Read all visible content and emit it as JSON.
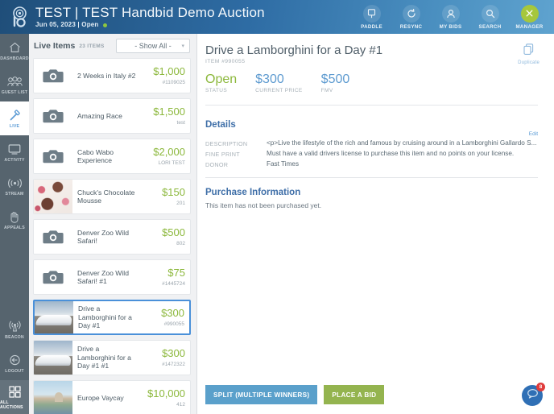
{
  "header": {
    "logo_icon": "handbid-logo-icon",
    "title": "TEST | TEST Handbid Demo Auction",
    "subtitle": "Jun 05, 2023 | Open",
    "actions": [
      {
        "label": "PADDLE",
        "icon": "paddle-icon"
      },
      {
        "label": "RESYNC",
        "icon": "resync-icon"
      },
      {
        "label": "MY BIDS",
        "icon": "user-icon"
      },
      {
        "label": "SEARCH",
        "icon": "search-icon"
      },
      {
        "label": "MANAGER",
        "icon": "close-x-icon"
      }
    ]
  },
  "rail": {
    "items": [
      {
        "label": "DASHBOARD",
        "icon": "home-icon",
        "active": false
      },
      {
        "label": "GUEST LIST",
        "icon": "people-icon",
        "active": false
      },
      {
        "label": "LIVE",
        "icon": "gavel-icon",
        "active": true
      },
      {
        "label": "ACTIVITY",
        "icon": "monitor-icon",
        "active": false
      },
      {
        "label": "STREAM",
        "icon": "broadcast-icon",
        "active": false
      },
      {
        "label": "APPEALS",
        "icon": "hand-icon",
        "active": false
      }
    ],
    "bottom_items": [
      {
        "label": "BEACON",
        "icon": "beacon-icon",
        "active": false
      },
      {
        "label": "LOGOUT",
        "icon": "logout-icon",
        "active": false
      },
      {
        "label": "ALL AUCTIONS",
        "icon": "grid-icon",
        "active": true
      }
    ]
  },
  "list": {
    "title": "Live Items",
    "count_label": "23 ITEMS",
    "filter_value": "- Show All -",
    "chevron_icon": "chevron-down-icon",
    "items": [
      {
        "name": "2 Weeks in Italy #2",
        "price": "$1,000",
        "code": "#1109025",
        "art": "placeholder",
        "selected": false
      },
      {
        "name": "Amazing Race",
        "price": "$1,500",
        "code": "test",
        "art": "placeholder",
        "selected": false
      },
      {
        "name": "Cabo Wabo Experience",
        "price": "$2,000",
        "code": "LORI TEST",
        "art": "placeholder",
        "selected": false
      },
      {
        "name": "Chuck's Chocolate Mousse",
        "price": "$150",
        "code": "201",
        "art": "mousse",
        "selected": false
      },
      {
        "name": "Denver Zoo Wild Safari!",
        "price": "$500",
        "code": "802",
        "art": "placeholder",
        "selected": false
      },
      {
        "name": "Denver Zoo Wild Safari! #1",
        "price": "$75",
        "code": "#1445724",
        "art": "placeholder",
        "selected": false
      },
      {
        "name": "Drive a Lamborghini for a Day  #1",
        "price": "$300",
        "code": "#990055",
        "art": "lambo",
        "selected": true
      },
      {
        "name": "Drive a Lamborghini for a Day  #1 #1",
        "price": "$300",
        "code": "#1472322",
        "art": "lambo",
        "selected": false
      },
      {
        "name": "Europe Vaycay",
        "price": "$10,000",
        "code": "412",
        "art": "europe",
        "selected": false
      }
    ]
  },
  "detail": {
    "title": "Drive a Lamborghini for a Day  #1",
    "item_id": "ITEM #990055",
    "duplicate_label": "Duplicate",
    "duplicate_icon": "duplicate-icon",
    "stats": [
      {
        "value": "Open",
        "caption": "STATUS"
      },
      {
        "value": "$300",
        "caption": "CURRENT PRICE"
      },
      {
        "value": "$500",
        "caption": "FMV"
      }
    ],
    "details_heading": "Details",
    "edit_label": "Edit",
    "fields": [
      {
        "key": "DESCRIPTION",
        "value": "<p>Live the lifestyle of the rich and famous by cruising around in a Lamborghini Gallardo S..."
      },
      {
        "key": "FINE PRINT",
        "value": "Must have a valid drivers license to purchase this item and no points on your license."
      },
      {
        "key": "DONOR",
        "value": "Fast Times"
      }
    ],
    "purchase_heading": "Purchase Information",
    "purchase_text": "This item has not been purchased yet.",
    "buttons": {
      "split_label": "SPLIT (MULTIPLE WINNERS)",
      "bid_label": "PLACE A BID"
    },
    "chat": {
      "icon": "chat-icon",
      "badge": "8"
    }
  }
}
